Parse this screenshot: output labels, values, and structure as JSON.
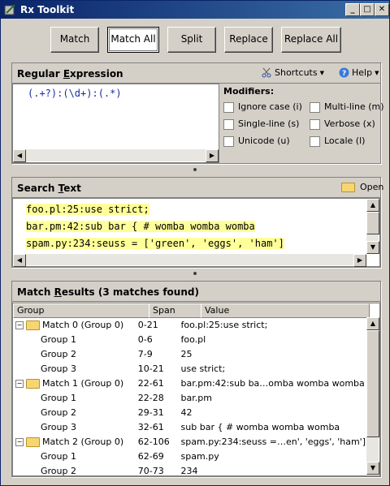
{
  "window": {
    "title": "Rx Toolkit"
  },
  "title_buttons": {
    "minimize": "_",
    "maximize": "□",
    "close": "✕"
  },
  "toolbar": {
    "match": "Match",
    "match_all": "Match All",
    "split": "Split",
    "replace": "Replace",
    "replace_all": "Replace All"
  },
  "regex_panel": {
    "label_prefix": "Regular ",
    "label_ul": "E",
    "label_suffix": "xpression",
    "shortcuts": "Shortcuts",
    "help": "Help",
    "pattern": "(.+?):(\\d+):(.*)"
  },
  "modifiers": {
    "title": "Modifiers:",
    "items": [
      "Ignore case (i)",
      "Multi-line (m)",
      "Single-line (s)",
      "Verbose (x)",
      "Unicode (u)",
      "Locale (l)"
    ]
  },
  "search_panel": {
    "label_prefix": "Search ",
    "label_ul": "T",
    "label_suffix": "ext",
    "open": "Open",
    "lines": [
      "foo.pl:25:use strict;",
      "bar.pm:42:sub bar { # womba womba womba",
      "spam.py:234:seuss = ['green', 'eggs', 'ham']"
    ]
  },
  "results_panel": {
    "label_prefix": "Match ",
    "label_ul": "R",
    "label_suffix": "esults (3 matches found)",
    "columns": [
      "Group",
      "Span",
      "Value"
    ],
    "rows": [
      {
        "group": "Match 0 (Group 0)",
        "span": "0-21",
        "value": "foo.pl:25:use strict;",
        "parent": true
      },
      {
        "group": "Group 1",
        "span": "0-6",
        "value": "foo.pl",
        "parent": false
      },
      {
        "group": "Group 2",
        "span": "7-9",
        "value": "25",
        "parent": false
      },
      {
        "group": "Group 3",
        "span": "10-21",
        "value": "use strict;",
        "parent": false
      },
      {
        "group": "Match 1 (Group 0)",
        "span": "22-61",
        "value": "bar.pm:42:sub ba…omba womba womba",
        "parent": true
      },
      {
        "group": "Group 1",
        "span": "22-28",
        "value": "bar.pm",
        "parent": false
      },
      {
        "group": "Group 2",
        "span": "29-31",
        "value": "42",
        "parent": false
      },
      {
        "group": "Group 3",
        "span": "32-61",
        "value": "sub bar { # womba womba womba",
        "parent": false
      },
      {
        "group": "Match 2 (Group 0)",
        "span": "62-106",
        "value": "spam.py:234:seuss =…en', 'eggs', 'ham']",
        "parent": true
      },
      {
        "group": "Group 1",
        "span": "62-69",
        "value": "spam.py",
        "parent": false
      },
      {
        "group": "Group 2",
        "span": "70-73",
        "value": "234",
        "parent": false
      }
    ]
  }
}
